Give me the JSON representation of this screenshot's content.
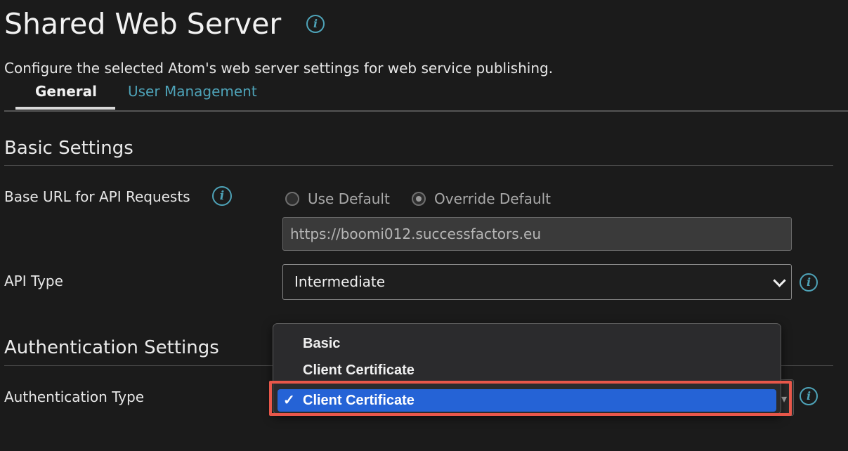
{
  "page": {
    "title": "Shared Web Server",
    "description": "Configure the selected Atom's web server settings for web service publishing."
  },
  "tabs": [
    {
      "label": "General",
      "active": true
    },
    {
      "label": "User Management",
      "active": false
    }
  ],
  "basic_settings": {
    "heading": "Basic Settings",
    "base_url": {
      "label": "Base URL for API Requests",
      "options": [
        "Use Default",
        "Override Default"
      ],
      "selected": "Override Default",
      "value": "https://boomi012.successfactors.eu"
    },
    "api_type": {
      "label": "API Type",
      "value": "Intermediate"
    }
  },
  "authentication_settings": {
    "heading": "Authentication Settings",
    "auth_type": {
      "label": "Authentication Type",
      "dropdown_options": [
        "Basic",
        "Client Certificate",
        "Client Certificate"
      ],
      "selected": "Client Certificate"
    }
  },
  "icons": {
    "info": "info-icon",
    "chevron": "chevron-down-icon",
    "check": "checkmark-icon"
  },
  "colors": {
    "background": "#1b1b1b",
    "accent_teal": "#4ea3b8",
    "selection_blue": "#2563d6",
    "highlight_red": "#e8574a"
  }
}
